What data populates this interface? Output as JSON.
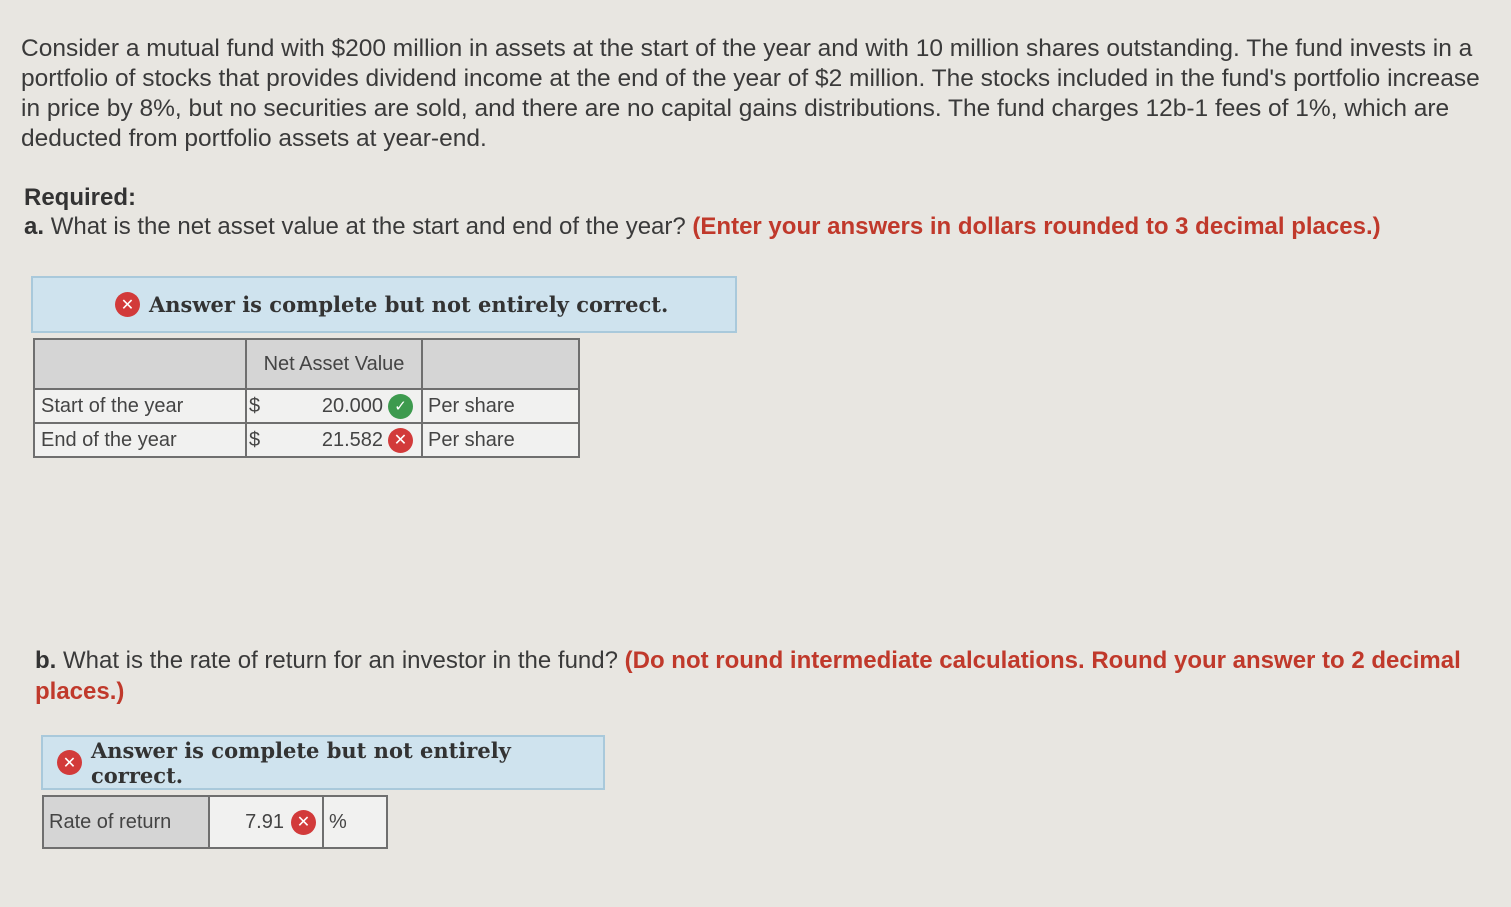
{
  "problem_text": "Consider a mutual fund with $200 million in assets at the start of the year and with 10 million shares outstanding. The fund invests in a portfolio of stocks that provides dividend income at the end of the year of $2 million. The stocks included in the fund's portfolio increase in price by 8%, but no securities are sold, and there are no capital gains distributions. The fund charges 12b-1 fees of 1%, which are deducted from portfolio assets at year-end.",
  "required_heading": "Required:",
  "part_a": {
    "label": "a.",
    "question": "What is the net asset value at the start and end of the year?",
    "instruction": "(Enter your answers in dollars rounded to 3 decimal places.)",
    "banner_text": "Answer is complete but not entirely correct.",
    "table": {
      "header": {
        "col1": "",
        "col2": "Net Asset Value",
        "col3": ""
      },
      "rows": [
        {
          "label": "Start of the year",
          "currency": "$",
          "value": "20.000",
          "status": "correct",
          "unit": "Per share"
        },
        {
          "label": "End of the year",
          "currency": "$",
          "value": "21.582",
          "status": "incorrect",
          "unit": "Per share"
        }
      ]
    }
  },
  "part_b": {
    "label": "b.",
    "question": "What is the rate of return for an investor in the fund?",
    "instruction": "(Do not round intermediate calculations. Round your answer to 2 decimal places.)",
    "banner_text": "Answer is complete but not entirely correct.",
    "row": {
      "label": "Rate of return",
      "value": "7.91",
      "status": "incorrect",
      "unit": "%"
    }
  },
  "colors": {
    "instruction_red": "#c0392b",
    "banner_bg": "#cfe3ee",
    "correct_green": "#3d9a4e",
    "incorrect_red": "#d23a3a"
  },
  "icons": {
    "correct": "check-icon",
    "incorrect": "x-icon"
  }
}
